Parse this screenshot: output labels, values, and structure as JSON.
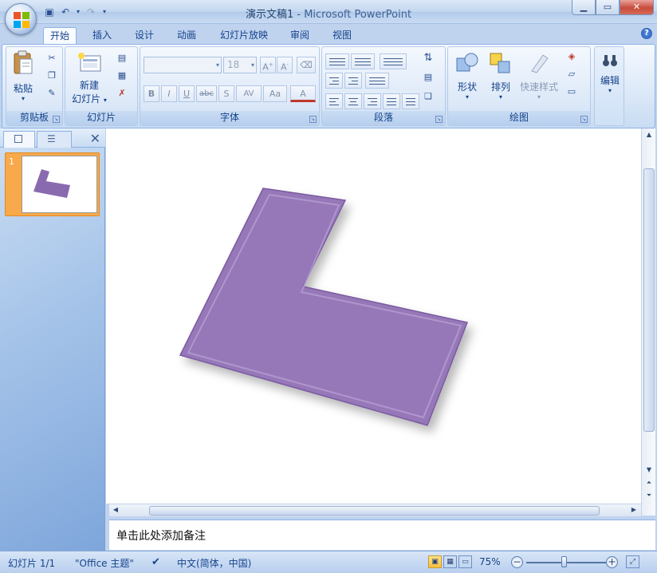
{
  "app": {
    "document_name": "演示文稿1",
    "separator": " - ",
    "app_name": "Microsoft PowerPoint"
  },
  "ribbon_tabs": [
    "开始",
    "插入",
    "设计",
    "动画",
    "幻灯片放映",
    "审阅",
    "视图"
  ],
  "ribbon": {
    "clipboard": {
      "label": "剪贴板",
      "paste": "粘贴"
    },
    "slides": {
      "label": "幻灯片",
      "new_slide_line1": "新建",
      "new_slide_line2": "幻灯片"
    },
    "font": {
      "label": "字体",
      "font_size": "18",
      "bold": "B",
      "italic": "I",
      "underline": "U",
      "strike": "abc",
      "shadow": "S",
      "spacing": "AV",
      "case": "Aa",
      "color": "A"
    },
    "paragraph": {
      "label": "段落"
    },
    "drawing": {
      "label": "绘图",
      "shapes": "形状",
      "arrange": "排列",
      "quick_styles": "快速样式"
    },
    "editing": {
      "label": "编辑"
    }
  },
  "slides_panel": {
    "slide_number": "1"
  },
  "notes": {
    "placeholder": "单击此处添加备注"
  },
  "status": {
    "slide": "幻灯片 1/1",
    "theme": "\"Office 主题\"",
    "language": "中文(简体，中国)",
    "zoom": "75%",
    "zoom_fraction": 0.47
  },
  "colors": {
    "shape_fill": "#9678b8",
    "thumbnail_fill": "#8a6aaf",
    "accent_orange": "#f7a94b"
  }
}
